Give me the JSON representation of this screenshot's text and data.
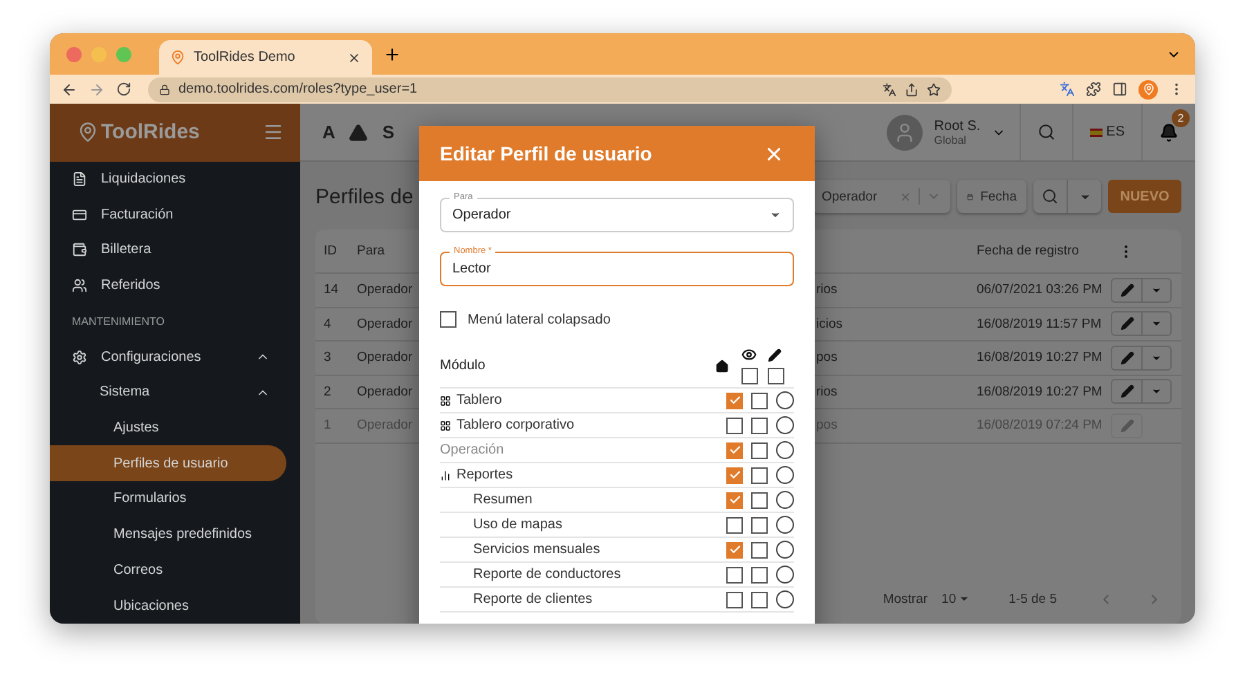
{
  "browser": {
    "tab_title": "ToolRides Demo",
    "url": "demo.toolrides.com/roles?type_user=1"
  },
  "header": {
    "logo": "ToolRides",
    "toolbar": [
      "A",
      "S"
    ],
    "user_name": "Root S.",
    "user_role": "Global",
    "language": "ES",
    "notifications": "2"
  },
  "sidebar": {
    "items": [
      {
        "label": "Liquidaciones",
        "kind": "link",
        "selected": false
      },
      {
        "label": "Facturación",
        "kind": "link",
        "selected": false
      },
      {
        "label": "Billetera",
        "kind": "link",
        "selected": false
      },
      {
        "label": "Referidos",
        "kind": "link",
        "selected": false
      },
      {
        "label": "MANTENIMIENTO",
        "kind": "section"
      },
      {
        "label": "Configuraciones",
        "kind": "group",
        "expanded": true,
        "children": [
          {
            "label": "Sistema",
            "kind": "group",
            "expanded": true,
            "children": [
              {
                "label": "Ajustes",
                "kind": "link",
                "selected": false
              },
              {
                "label": "Perfiles de usuario",
                "kind": "link",
                "selected": true
              },
              {
                "label": "Formularios",
                "kind": "link",
                "selected": false
              },
              {
                "label": "Mensajes predefinidos",
                "kind": "link",
                "selected": false
              },
              {
                "label": "Correos",
                "kind": "link",
                "selected": false
              },
              {
                "label": "Ubicaciones",
                "kind": "link",
                "selected": false
              }
            ]
          }
        ]
      }
    ]
  },
  "page": {
    "title": "Perfiles de",
    "filter": "Operador",
    "date_button": "Fecha",
    "new_button": "NUEVO"
  },
  "table": {
    "columns": [
      "ID",
      "Para",
      "Fecha de registro"
    ],
    "rows": [
      {
        "id": "14",
        "para": "Operador",
        "column_3": "rios",
        "date": "06/07/2021 03:26 PM",
        "disabled": false
      },
      {
        "id": "4",
        "para": "Operador",
        "column_3": "icios",
        "date": "16/08/2019 11:57 PM",
        "disabled": false
      },
      {
        "id": "3",
        "para": "Operador",
        "column_3": "pos",
        "date": "16/08/2019 10:27 PM",
        "disabled": false
      },
      {
        "id": "2",
        "para": "Operador",
        "column_3": "rios",
        "date": "16/08/2019 10:27 PM",
        "disabled": false
      },
      {
        "id": "1",
        "para": "Operador",
        "column_3": "pos",
        "date": "16/08/2019 07:24 PM",
        "disabled": true
      }
    ]
  },
  "pagination": {
    "label": "Mostrar",
    "page_size": "10",
    "range": "1-5 de 5"
  },
  "modal": {
    "title": "Editar Perfil de usuario",
    "para": {
      "label": "Para",
      "value": "Operador"
    },
    "nombre": {
      "label": "Nombre *",
      "value": "Lector",
      "focused": true
    },
    "collapsed_menu": {
      "label": "Menú lateral colapsado",
      "checked": false
    },
    "module_header": "Módulo",
    "view_all": false,
    "edit_all": false,
    "modules": [
      {
        "label": "Tablero",
        "kind": "module",
        "view": true,
        "edit": false,
        "home": false
      },
      {
        "label": "Tablero corporativo",
        "kind": "module",
        "view": false,
        "edit": false,
        "home": false
      },
      {
        "label": "Operación",
        "kind": "section",
        "view": true,
        "edit": false,
        "home": false
      },
      {
        "label": "Reportes",
        "kind": "report",
        "view": true,
        "edit": false,
        "home": false,
        "children": [
          {
            "label": "Resumen",
            "kind": "module",
            "view": true,
            "edit": false,
            "home": false
          },
          {
            "label": "Uso de mapas",
            "kind": "module",
            "view": false,
            "edit": false,
            "home": false
          },
          {
            "label": "Servicios mensuales",
            "kind": "module",
            "view": true,
            "edit": false,
            "home": false
          },
          {
            "label": "Reporte de conductores",
            "kind": "module",
            "view": false,
            "edit": false,
            "home": false
          },
          {
            "label": "Reporte de clientes",
            "kind": "module",
            "view": false,
            "edit": false,
            "home": false
          }
        ]
      }
    ]
  }
}
